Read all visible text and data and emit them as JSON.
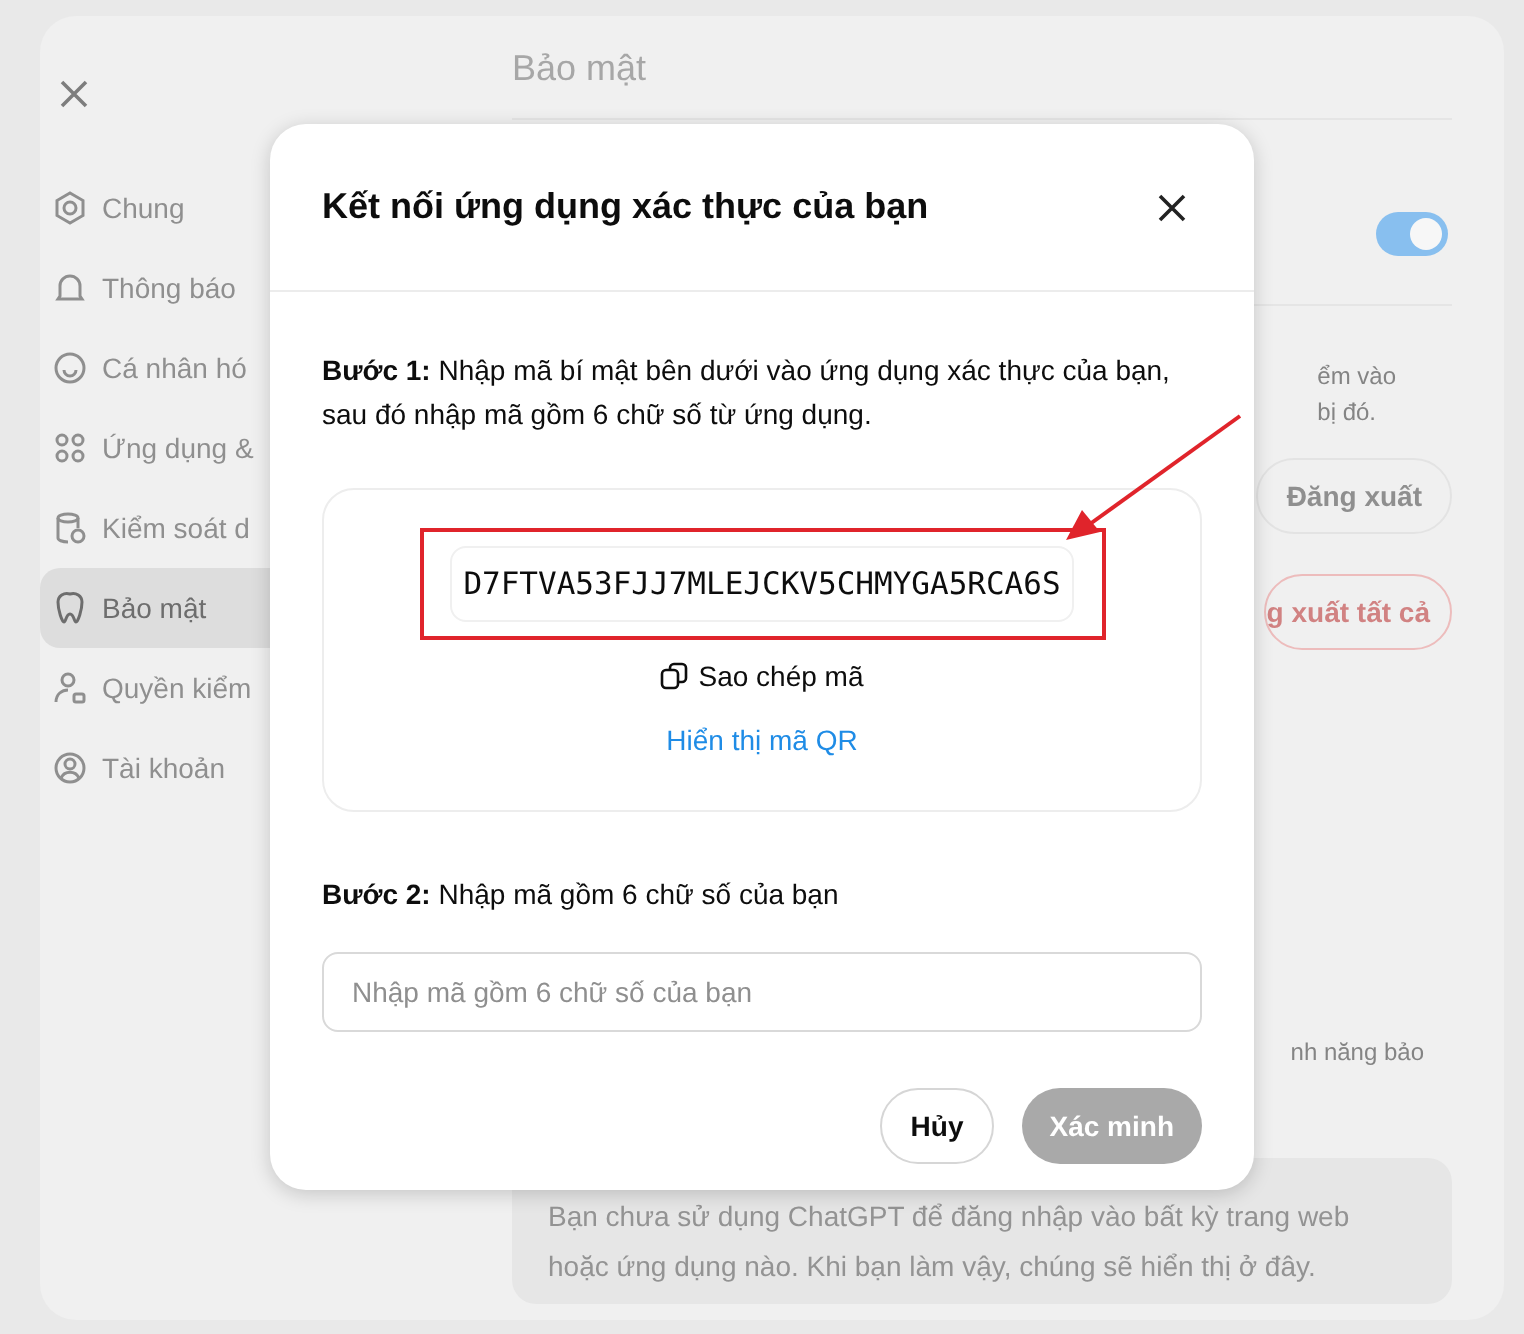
{
  "sidebar": {
    "items": [
      {
        "label": "Chung",
        "selected": false
      },
      {
        "label": "Thông báo",
        "selected": false
      },
      {
        "label": "Cá nhân hó",
        "selected": false
      },
      {
        "label": "Ứng dụng &",
        "selected": false
      },
      {
        "label": "Kiểm soát d",
        "selected": false
      },
      {
        "label": "Bảo mật",
        "selected": true
      },
      {
        "label": "Quyền kiểm",
        "selected": false
      },
      {
        "label": "Tài khoản",
        "selected": false
      }
    ]
  },
  "content": {
    "title": "Bảo mật",
    "toggle": {
      "on": true
    },
    "hint_lines": [
      "ểm vào",
      "bị đó."
    ],
    "logout_button": "Đăng xuất",
    "logout_all_button": "g xuất tất cả",
    "feature_text": "nh năng bảo",
    "empty_note": "Bạn chưa sử dụng ChatGPT để đăng nhập vào bất kỳ trang web hoặc ứng dụng nào. Khi bạn làm vậy, chúng sẽ hiển thị ở đây."
  },
  "dialog": {
    "title": "Kết nối ứng dụng xác thực của bạn",
    "step1": "**Bước 1:** Nhập mã bí mật bên dưới vào ứng dụng xác thực của bạn, sau đó nhập mã gồm 6 chữ số từ ứng dụng.",
    "secret_code": "D7FTVA53FJJ7MLEJCKV5CHMYGA5RCA6S",
    "copy_link": "Sao chép mã",
    "qr_link": "Hiển thị mã QR",
    "step2": "**Bước 2:** Nhập mã gồm 6 chữ số của bạn",
    "code_field": {
      "placeholder": "Nhập mã gồm 6 chữ số của bạn"
    },
    "cancel_button": "Hủy",
    "verify_button": {
      "label": "Xác minh",
      "disabled": true
    }
  }
}
